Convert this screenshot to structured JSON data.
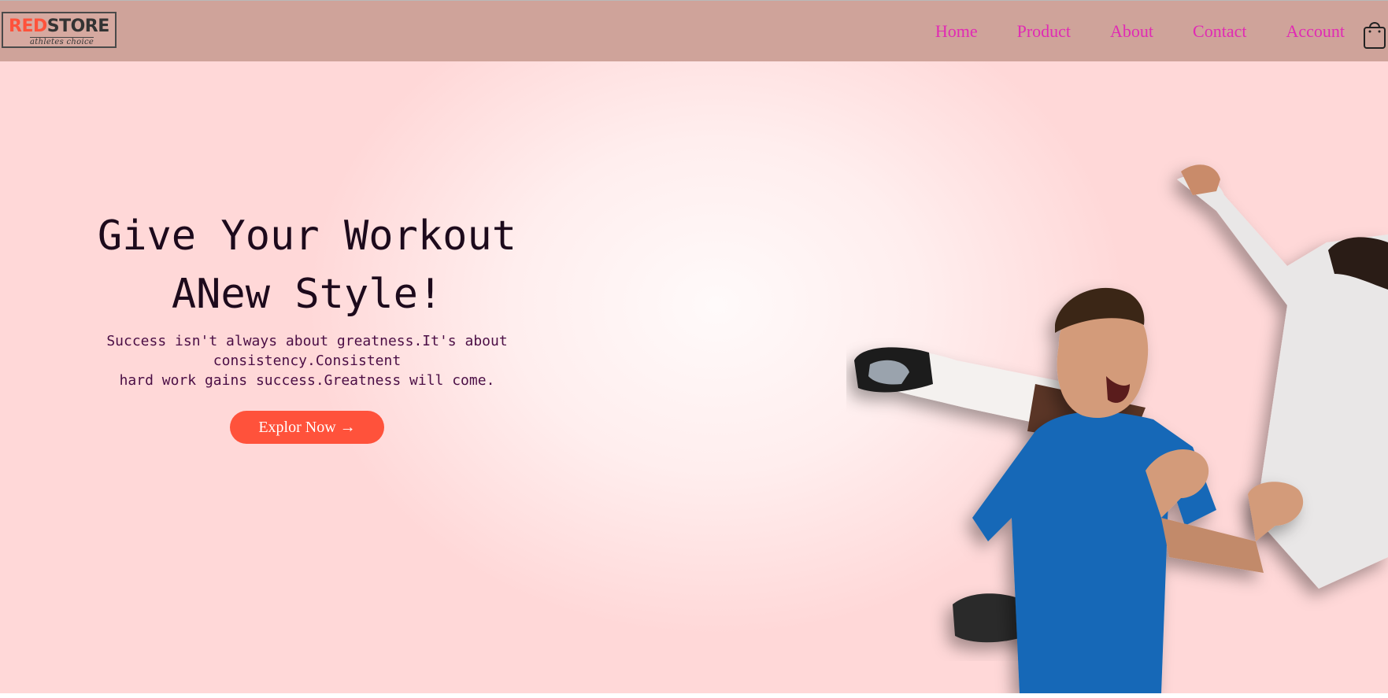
{
  "navbar": {
    "logo": {
      "word_red": "RED",
      "word_dark": "STORE",
      "tagline": "athletes choice"
    },
    "links": [
      "Home",
      "Product",
      "About",
      "Contact",
      "Account"
    ],
    "cart_icon": "shopping-bag-icon"
  },
  "hero": {
    "title_line1": "Give Your Workout",
    "title_line2": "ANew Style!",
    "desc_line1": "Success isn't always about greatness.It's about",
    "desc_line2": "consistency.Consistent",
    "desc_line3": "hard work gains success.Greatness will come.",
    "cta_label": "Explor Now →",
    "image": "celebrating-football-players-photo"
  },
  "colors": {
    "navbar_bg": "#cfa39a",
    "accent": "#ff523b",
    "nav_link": "#e12ab4",
    "hero_title": "#1d0a1c",
    "hero_text": "#4b0e45"
  }
}
